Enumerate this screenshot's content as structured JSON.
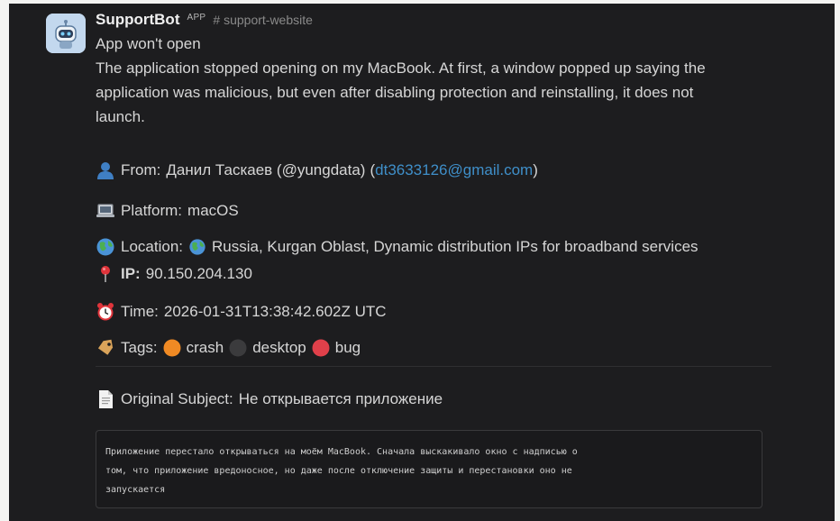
{
  "bot": {
    "name": "SupportBot",
    "badge": "APP",
    "channel": "# support-website"
  },
  "ticket": {
    "title": "App won't open",
    "description_lines": [
      "The application stopped opening on my MacBook. At first, a window popped up saying the",
      "application was malicious, but even after disabling protection and reinstalling, it does not",
      "launch."
    ]
  },
  "fields": {
    "from_label": "From:",
    "from_name": "Данил Таскаев (@yungdata)",
    "from_email": "dt3633126@gmail.com",
    "platform_label": "Platform:",
    "platform_value": "macOS",
    "location_label": "Location:",
    "location_value": "Russia, Kurgan Oblast, Dynamic distribution IPs for broadband services",
    "ip_label": "IP:",
    "ip_value": "90.150.204.130",
    "time_label": "Time:",
    "time_value": "2026-01-31T13:38:42.602Z UTC",
    "tags_label": "Tags:",
    "tags": [
      {
        "label": "crash",
        "color": "#f08a24"
      },
      {
        "label": "desktop",
        "color": "#3b3b3d"
      },
      {
        "label": "bug",
        "color": "#e0404a"
      }
    ],
    "subject_label": "Original Subject:",
    "subject_value": "Не открывается приложение"
  },
  "original_message_lines": [
    "Приложение перестало открываться на моём MacBook. Сначала выскакивало окно с надписью о",
    "том, что приложение вредоносное, но даже после отключение защиты и перестановки оно не",
    "запускается"
  ],
  "icons": {
    "from": "person-icon",
    "platform": "laptop-icon",
    "location": "globe-icon",
    "ip": "pin-icon",
    "time": "alarm-clock-icon",
    "tags": "tag-icon",
    "subject": "document-icon"
  }
}
